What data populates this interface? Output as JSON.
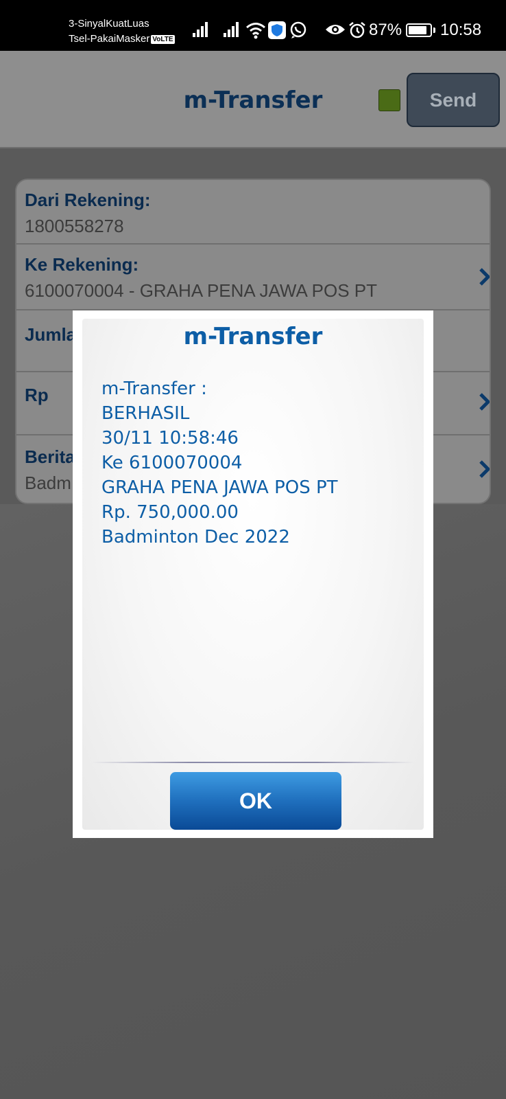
{
  "status_bar": {
    "carrier_line1": "3-SinyalKuatLuas",
    "carrier_line2": "Tsel-PakaiMasker",
    "volte": "VoLTE",
    "battery_percent": "87%",
    "battery_level": 0.87,
    "time": "10:58",
    "icons": [
      "signal-icon",
      "signal-icon",
      "wifi-icon",
      "shield-icon",
      "whatsapp-icon",
      "eye-icon",
      "alarm-icon",
      "battery-icon"
    ]
  },
  "app_bar": {
    "title": "m-Transfer",
    "send_label": "Send",
    "status_color": "#4a6b16"
  },
  "form": {
    "rows": [
      {
        "label": "Dari Rekening:",
        "value": "1800558278"
      },
      {
        "label": "Ke Rekening:",
        "value": "6100070004 - GRAHA PENA JAWA POS PT"
      },
      {
        "label": "Jumla",
        "value": ""
      },
      {
        "label": "Rp",
        "value": ""
      },
      {
        "label": "Berita",
        "value": "Badm"
      }
    ]
  },
  "dialog": {
    "title": "m-Transfer",
    "lines": [
      "m-Transfer :",
      "BERHASIL",
      "30/11 10:58:46",
      "Ke 6100070004",
      "GRAHA PENA JAWA POS PT",
      "Rp. 750,000.00",
      "Badminton Dec 2022"
    ],
    "ok_label": "OK"
  },
  "colors": {
    "brand_blue": "#0d5ea6",
    "ok_button": "#1f6fbd",
    "overlay_dim": "#5a5a5a"
  }
}
